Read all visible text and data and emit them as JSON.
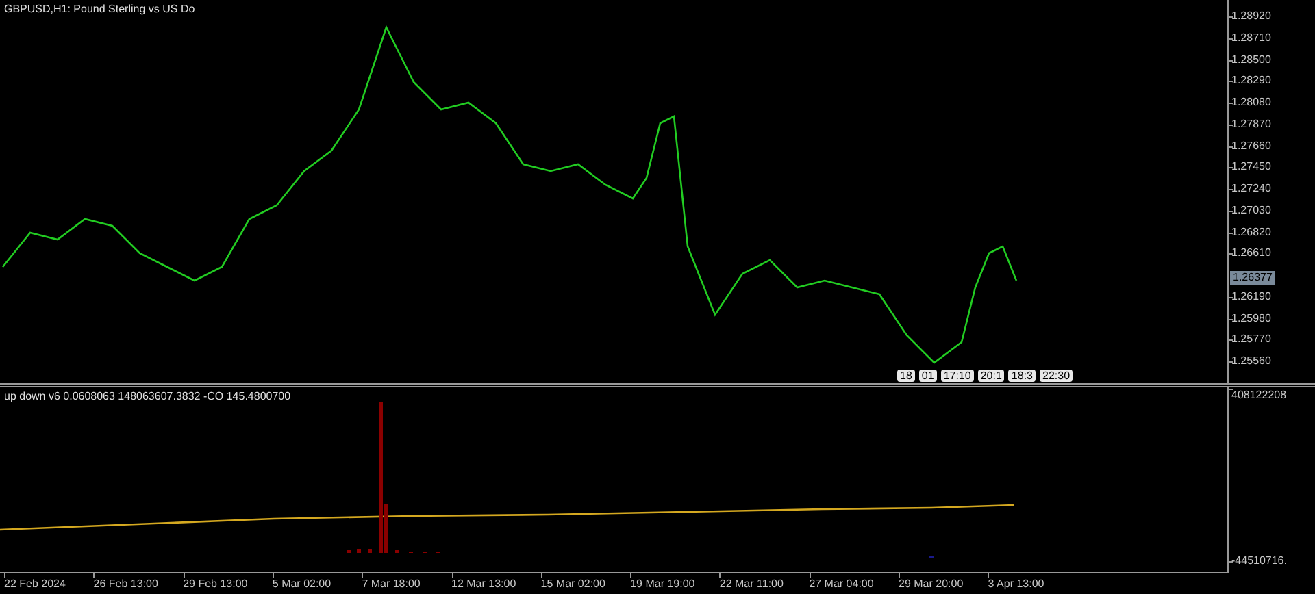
{
  "main_chart": {
    "title": "GBPUSD,H1:  Pound Sterling vs US Do",
    "price_labels": [
      "1.28920",
      "1.28710",
      "1.28500",
      "1.28290",
      "1.28080",
      "1.27870",
      "1.27660",
      "1.27450",
      "1.27240",
      "1.27030",
      "1.26820",
      "1.26610",
      "1.26190",
      "1.25980",
      "1.25770",
      "1.25560"
    ],
    "current_price": "1.26377",
    "trade_labels": [
      "18",
      "01",
      "17:10",
      "20:1",
      "18:3",
      "22:30"
    ]
  },
  "indicator": {
    "title": "up down v6 0.0608063 148063607.3832 -CO 145.4800700",
    "scale_labels": [
      "408122208",
      "-44510716."
    ]
  },
  "time_axis": {
    "labels": [
      "22 Feb 2024",
      "26 Feb 13:00",
      "29 Feb 13:00",
      "5 Mar 02:00",
      "7 Mar 18:00",
      "12 Mar 13:00",
      "15 Mar 02:00",
      "19 Mar 19:00",
      "22 Mar 11:00",
      "27 Mar 04:00",
      "29 Mar 20:00",
      "3 Apr 13:00"
    ]
  }
}
